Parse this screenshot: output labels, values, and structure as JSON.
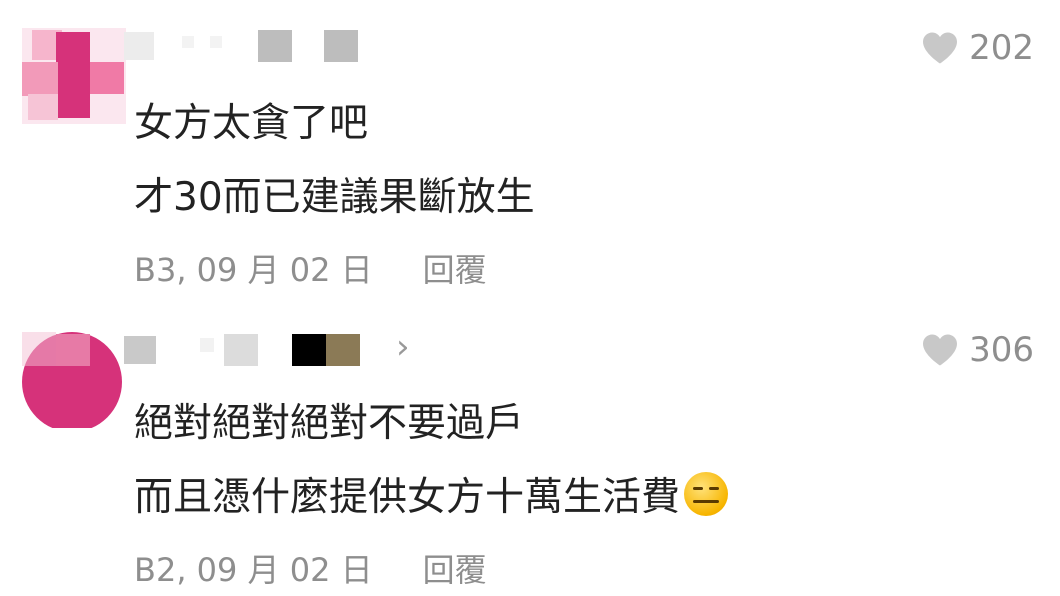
{
  "comments": [
    {
      "likes": "202",
      "lines": [
        "女方太貪了吧",
        "才30而已建議果斷放生"
      ],
      "meta": "B3, 09 月 02 日",
      "reply_label": "回覆"
    },
    {
      "likes": "306",
      "lines": [
        "絕對絕對絕對不要過戶",
        "而且憑什麼提供女方十萬生活費"
      ],
      "meta": "B2, 09 月 02 日",
      "reply_label": "回覆"
    }
  ],
  "icons": {
    "heart": "heart-icon",
    "chevron": "chevron-right-icon",
    "emoji": "expressionless-face-emoji"
  },
  "colors": {
    "heart": "#c8c8c8",
    "secondary_text": "#8e8e8e",
    "avatar_pink": "#d6327a"
  }
}
